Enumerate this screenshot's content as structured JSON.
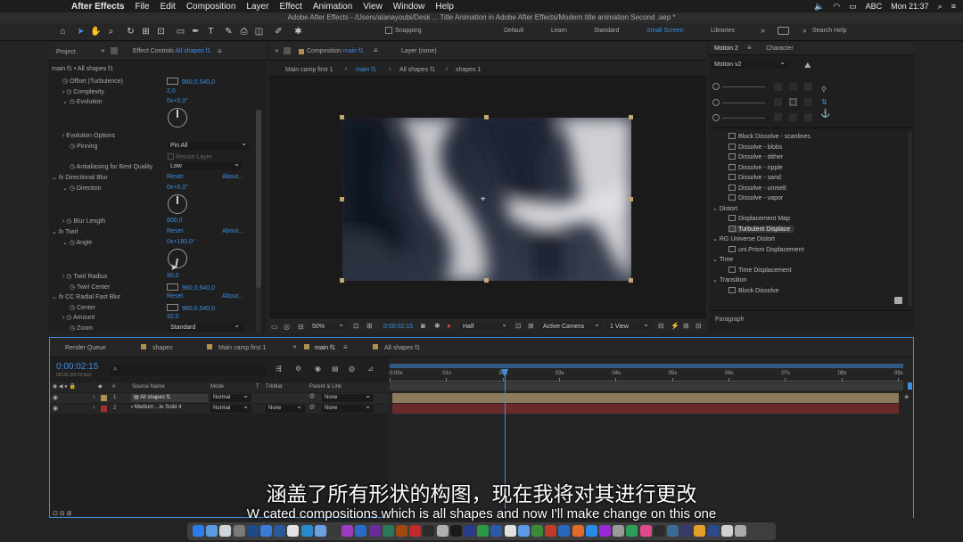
{
  "menubar": {
    "app_name": "After Effects",
    "items": [
      "File",
      "Edit",
      "Composition",
      "Layer",
      "Effect",
      "Animation",
      "View",
      "Window",
      "Help"
    ],
    "status_text": "ABC",
    "clock": "Mon 21:37"
  },
  "window_title": "Adobe After Effects - /Users/alanayoubi/Desk ... Title Animation in Adobe After Effects/Modern title animation Second .aep *",
  "toolbar": {
    "snapping_label": "Snapping",
    "workspaces": [
      "Default",
      "Learn",
      "Standard",
      "Small Screen",
      "Libraries"
    ],
    "active_workspace": "Small Screen",
    "search_placeholder": "Search Help"
  },
  "left_panel": {
    "tab_project": "Project",
    "tab_effect_controls": "Effect Controls",
    "tab_effect_controls_target": "All shapes f1",
    "subheader": "main f1 • All shapes f1",
    "rows": [
      {
        "label": "Offset (Turbulence)",
        "value": "960,0,540,0"
      },
      {
        "label": "Complexity",
        "value": "2,0"
      },
      {
        "label": "Evolution",
        "value": "0x+0,0°"
      },
      {
        "label": "Evolution Options",
        "value": ""
      },
      {
        "label": "Pinning",
        "value": "Pin All"
      },
      {
        "label": "Resize Layer",
        "value": ""
      },
      {
        "label": "Antialiasing for Best Quality",
        "value": "Low"
      },
      {
        "label": "Directional Blur",
        "value": "Reset",
        "extra": "About..."
      },
      {
        "label": "Direction",
        "value": "0x+0,0°"
      },
      {
        "label": "Blur Length",
        "value": "600,0"
      },
      {
        "label": "Twirl",
        "value": "Reset",
        "extra": "About..."
      },
      {
        "label": "Angle",
        "value": "0x+190,0°"
      },
      {
        "label": "Twirl Radius",
        "value": "90,0"
      },
      {
        "label": "Twirl Center",
        "value": "960,0,540,0"
      },
      {
        "label": "CC Radial Fast Blur",
        "value": "Reset",
        "extra": "About..."
      },
      {
        "label": "Center",
        "value": "960,0,540,0"
      },
      {
        "label": "Amount",
        "value": "32,0"
      },
      {
        "label": "Zoom",
        "value": "Standard"
      }
    ]
  },
  "comp_panel": {
    "tab_composition": "Composition",
    "tab_composition_name": "main f1",
    "tab_layer": "Layer (none)",
    "breadcrumbs": [
      "Main camp first 1",
      "main f1",
      "All shapes f1",
      "shapes 1"
    ],
    "footer": {
      "zoom": "50%",
      "timecode": "0:00:02:15",
      "resolution": "Half",
      "camera": "Active Camera",
      "views": "1 View"
    }
  },
  "right_panel": {
    "tab_motion": "Motion 2",
    "tab_character": "Character",
    "motion_dropdown": "Motion v2",
    "effects": [
      {
        "label": "Block Dissolve - scanlines",
        "type": "item"
      },
      {
        "label": "Dissolve - blobs",
        "type": "item"
      },
      {
        "label": "Dissolve - dither",
        "type": "item"
      },
      {
        "label": "Dissolve - ripple",
        "type": "item"
      },
      {
        "label": "Dissolve - sand",
        "type": "item"
      },
      {
        "label": "Dissolve - unmelt",
        "type": "item"
      },
      {
        "label": "Dissolve - vapor",
        "type": "item"
      },
      {
        "label": "Distort",
        "type": "category"
      },
      {
        "label": "Displacement Map",
        "type": "item"
      },
      {
        "label": "Turbulent Displace",
        "type": "item",
        "selected": true
      },
      {
        "label": "RG Universe Distort",
        "type": "category"
      },
      {
        "label": "uni.Prism Displacement",
        "type": "item"
      },
      {
        "label": "Time",
        "type": "category"
      },
      {
        "label": "Time Displacement",
        "type": "item"
      },
      {
        "label": "Transition",
        "type": "category"
      },
      {
        "label": "Block Dissolve",
        "type": "item"
      }
    ],
    "paragraph_label": "Paragraph"
  },
  "timeline": {
    "tabs": [
      "Render Queue",
      "shapes",
      "Main camp first 1",
      "main f1",
      "All shapes f1"
    ],
    "active_tab": "main f1",
    "timecode": "0:00:02:15",
    "frame_info": "00135 (60.00 fps)",
    "columns": {
      "source_name": "Source Name",
      "mode": "Mode",
      "t": "T",
      "trkmat": "TrkMat",
      "parent": "Parent & Link"
    },
    "layers": [
      {
        "num": "1",
        "name": "All shapes f1",
        "mode": "Normal",
        "trkmat": "",
        "parent": "None",
        "color": "#b09050"
      },
      {
        "num": "2",
        "name": "Medium ...le Solid 4",
        "mode": "Normal",
        "trkmat": "None",
        "parent": "None",
        "color": "#a03030"
      }
    ],
    "ruler_ticks": [
      "0:00s",
      "01s",
      "02s",
      "03s",
      "04s",
      "05s",
      "06s",
      "07s",
      "08s",
      "09s"
    ],
    "current_time_fraction": 0.224
  },
  "subtitles": {
    "chinese": "涵盖了所有形状的构图，现在我将对其进行更改",
    "english": "W cated compositions which is all shapes and now I'll make change on this one"
  },
  "colors": {
    "accent_blue": "#3d8fe0",
    "layer1_bar": "#8c7a5a",
    "layer2_bar": "#6a2a2a",
    "playhead": "#3d8fe0"
  }
}
